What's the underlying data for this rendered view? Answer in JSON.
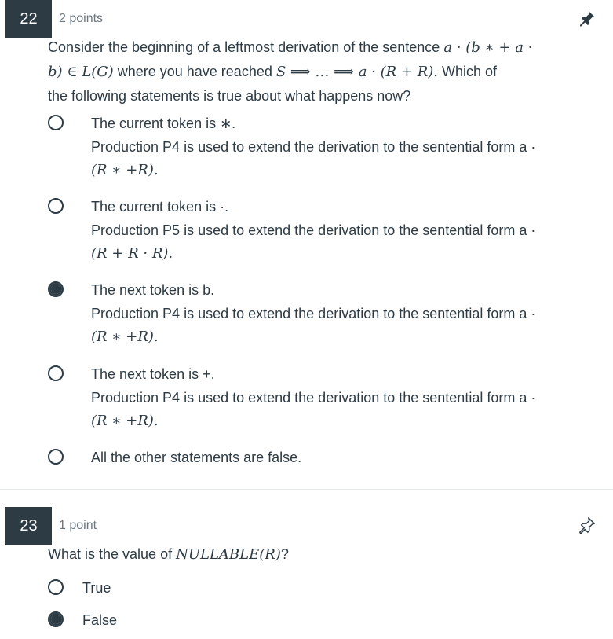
{
  "q22": {
    "number": "22",
    "points": "2 points",
    "prompt_a": "Consider the beginning of a leftmost derivation of the sentence",
    "prompt_sentence": "a · (b ∗ + a ·",
    "prompt_sentence2": "b) ∈ L(G)",
    "prompt_b": "where you have reached",
    "prompt_deriv": "S ⟹ … ⟹ a · (R + R).",
    "prompt_c": "Which of",
    "prompt_d": "the following statements is true about what happens now?",
    "options": [
      {
        "line1": "The current token is ∗.",
        "line2": "Production P4 is used to extend the derivation to the sentential form a ·",
        "line3": "(R ∗ +R).",
        "selected": false
      },
      {
        "line1": "The current token is ·.",
        "line2": "Production P5 is used to extend the derivation to the sentential form a ·",
        "line3": "(R + R · R).",
        "selected": false
      },
      {
        "line1": "The next token is b.",
        "line2": "Production P4 is used to extend the derivation to the sentential form a ·",
        "line3": "(R ∗ +R).",
        "selected": true
      },
      {
        "line1": "The next token is +.",
        "line2": "Production P4 is used to extend the derivation to the sentential form a ·",
        "line3": "(R ∗ +R).",
        "selected": false
      },
      {
        "line1": "All the other statements are false.",
        "selected": false
      }
    ]
  },
  "q23": {
    "number": "23",
    "points": "1 point",
    "prompt_a": "What is the value of",
    "prompt_math": "NULLABLE(R)",
    "prompt_b": "?",
    "options": [
      {
        "label": "True",
        "selected": false
      },
      {
        "label": "False",
        "selected": true
      }
    ]
  },
  "icons": {
    "pin_filled": "pin-icon",
    "pin_outline": "pin-outline-icon"
  },
  "colors": {
    "badge_bg": "#2d3b45",
    "text": "#2d3b45",
    "muted": "#6b7780"
  }
}
